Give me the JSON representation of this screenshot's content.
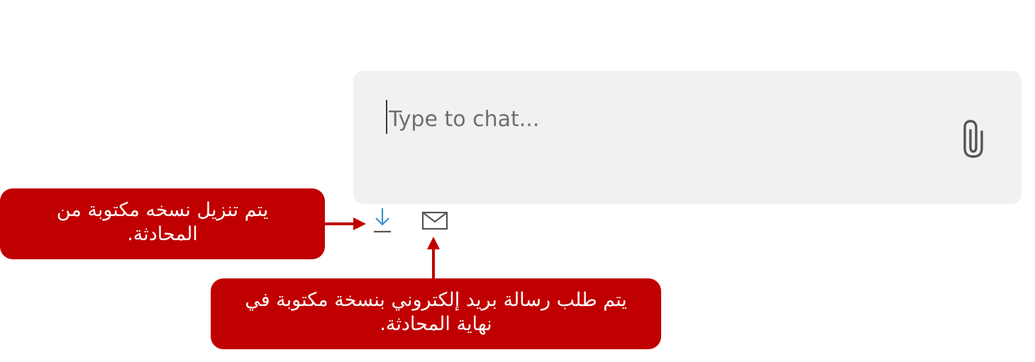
{
  "chat": {
    "input_placeholder": "Type to chat...",
    "input_value": ""
  },
  "icons": {
    "attach": "paperclip-icon",
    "download": "download-icon",
    "email": "envelope-icon"
  },
  "callouts": {
    "download": {
      "line1": "يتم تنزيل نسخه مكتوبة من",
      "line2": "المحادثة."
    },
    "email": {
      "line1": "يتم طلب رسالة بريد إلكتروني بنسخة مكتوبة في",
      "line2": "نهاية المحادثة."
    }
  },
  "colors": {
    "callout_background": "#c00000",
    "chat_background": "#f1f1f3",
    "download_icon": "#3c8fc8",
    "arrow": "#c00000"
  }
}
